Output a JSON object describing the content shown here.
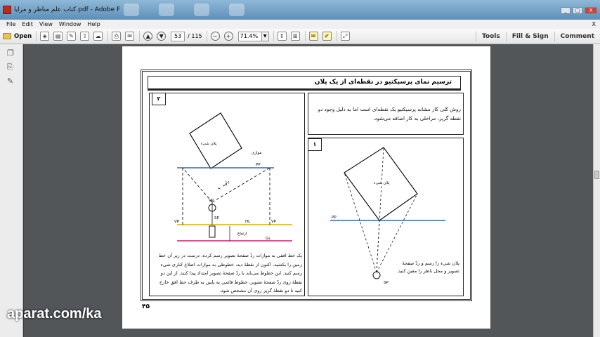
{
  "window": {
    "title": "کتاب علم مناظر و مرایا.pdf - Adobe Reader",
    "controls": {
      "minimize": "_",
      "maximize": "□",
      "close": "X"
    }
  },
  "menu": {
    "items": [
      "File",
      "Edit",
      "View",
      "Window",
      "Help"
    ],
    "close_doc": "X"
  },
  "toolbar": {
    "open_label": "Open",
    "page_current": "53",
    "page_total": "/ 115",
    "zoom": "71.4%",
    "tools_label": "Tools",
    "fill_sign_label": "Fill & Sign",
    "comment_label": "Comment"
  },
  "document": {
    "heading": "ترسیم نمای پرسپکتیو در نقطه‌ای از یک پلان",
    "panel_2_number": "۲",
    "panel_1_number": "۱",
    "intro_text": "روش کلی کار مشابه پرسپکتیو یک نقطه‌ای است اما به دلیل وجود دو نقطه گریز، مراحلی به کار اضافه می‌شود.",
    "panel_1_caption": "پلان شیء را رسم و ردّ صفحهٔ تصویر و محل ناظر را معین کنید.",
    "panel_2_caption": "یک خط افقی به موازات ردّ صفحهٔ تصویر رسم کرده، درست در زیر آن خط زمین را بکشید. اکنون از نقطهٔ دید، خطوطی به موازات اضلاع کناری شیء رسم کنید. این خطوط می‌باید با ردّ صفحهٔ تصویر امتداد پیدا کنند. از این دو نقطهٔ روی ردّ صفحهٔ تصویر، خطوط قائمی به پایین به طرف خط افق خارج کنید تا دو نقطهٔ گریز روی آن مشخص شود.",
    "page_number": "۴۵",
    "labels": {
      "plan": "پلان شیء",
      "pp": "PP",
      "vp": "VP",
      "sp": "SP",
      "hl": "HL",
      "gl": "GL",
      "height": "ارتفاع",
      "angle": "زاویه ۹۰",
      "parallel": "موازی"
    }
  },
  "watermark": "aparat.com/ka",
  "colors": {
    "titlebar": "#6f9cc4",
    "pp_line": "#2b6db5",
    "hl_line": "#d8b000",
    "gl_line": "#c0206a"
  }
}
